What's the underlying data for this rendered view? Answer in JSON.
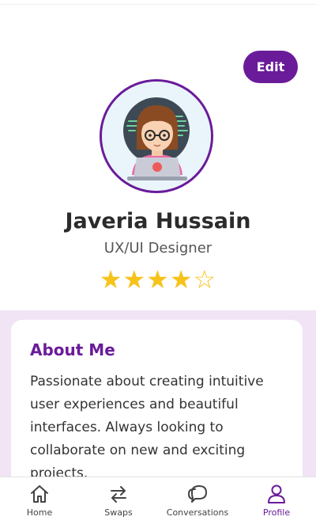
{
  "profile": {
    "edit_label": "Edit",
    "name": "Javeria Hussain",
    "role": "UX/UI Designer",
    "rating": {
      "value": 4,
      "max": 5
    }
  },
  "about": {
    "title": "About Me",
    "text": "Passionate about creating intuitive user experiences and beautiful interfaces. Always looking to collaborate on new and exciting projects."
  },
  "nav": {
    "items": [
      {
        "label": "Home",
        "icon": "home-icon"
      },
      {
        "label": "Swaps",
        "icon": "swap-arrows-icon"
      },
      {
        "label": "Conversations",
        "icon": "chat-bubbles-icon"
      },
      {
        "label": "Profile",
        "icon": "person-icon",
        "active": true
      }
    ]
  },
  "colors": {
    "accent": "#6a1b9a",
    "star": "#f7c21a",
    "content_bg": "#f1e4f5"
  }
}
